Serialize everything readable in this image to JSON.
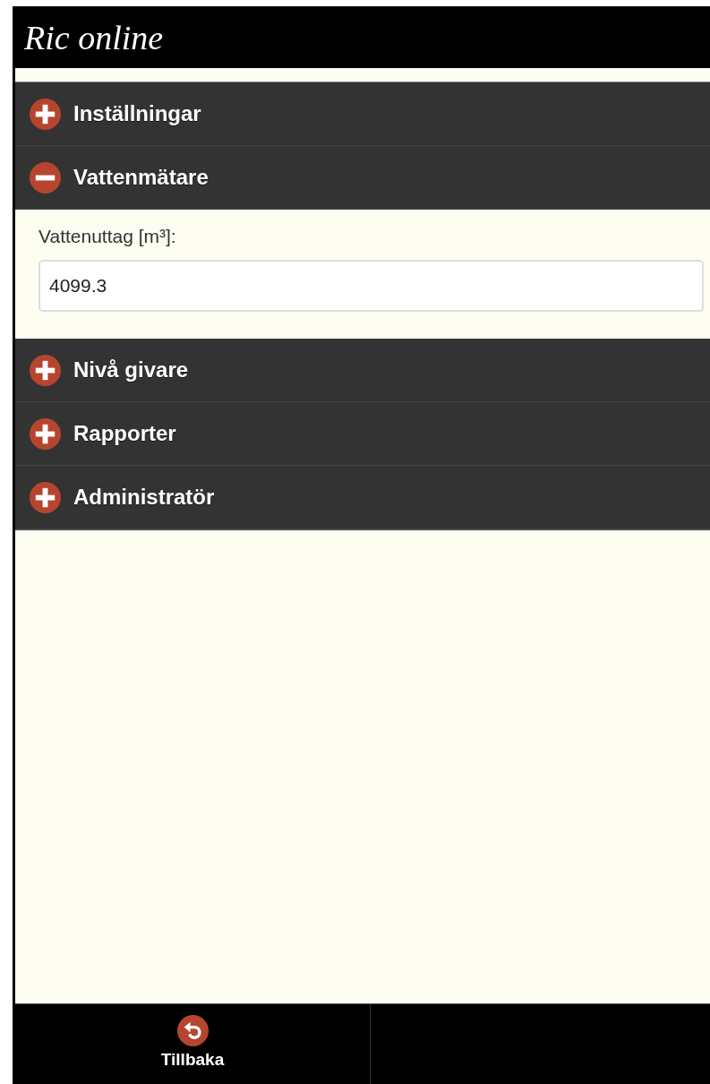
{
  "header": {
    "logo": "Ric online"
  },
  "sections": [
    {
      "title": "Inställningar",
      "expanded": false
    },
    {
      "title": "Vattenmätare",
      "expanded": true,
      "fields": [
        {
          "label": "Vattenuttag [m³]:",
          "value": "4099.3"
        }
      ]
    },
    {
      "title": "Nivå givare",
      "expanded": false
    },
    {
      "title": "Rapporter",
      "expanded": false
    },
    {
      "title": "Administratör",
      "expanded": false
    }
  ],
  "footer": {
    "buttons": [
      {
        "label": "Tillbaka"
      }
    ]
  }
}
